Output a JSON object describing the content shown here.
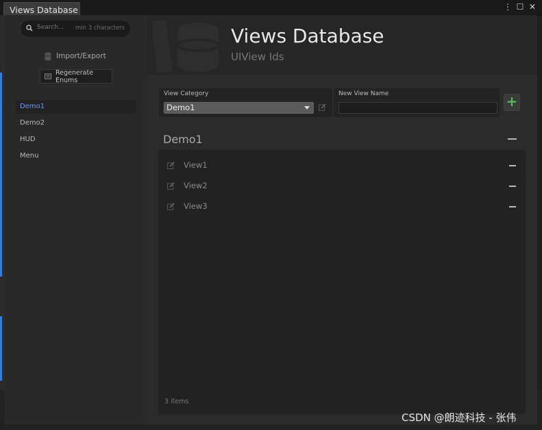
{
  "window": {
    "tab_title": "Views Database",
    "controls": {
      "more": "⋮",
      "maximize": "☐",
      "close": "✕"
    }
  },
  "sidebar": {
    "search": {
      "placeholder": "Search...",
      "hint": "min 3 characters"
    },
    "import_export_label": "Import/Export",
    "regenerate_label": "Regenerate Enums",
    "items": [
      {
        "label": "Demo1",
        "active": true
      },
      {
        "label": "Demo2",
        "active": false
      },
      {
        "label": "HUD",
        "active": false
      },
      {
        "label": "Menu",
        "active": false
      }
    ]
  },
  "header": {
    "title": "Views Database",
    "subtitle": "UIView Ids"
  },
  "form": {
    "category_label": "View Category",
    "category_value": "Demo1",
    "new_name_label": "New View Name",
    "new_name_value": "",
    "add_label": "+"
  },
  "section": {
    "title": "Demo1",
    "views": [
      {
        "name": "View1"
      },
      {
        "name": "View2"
      },
      {
        "name": "View3"
      }
    ],
    "count_text": "3 items"
  },
  "watermark": "CSDN @朗迹科技 - 张伟",
  "colors": {
    "accent_blue": "#6b9cff",
    "add_green": "#5cb85c",
    "background": "#2b2b2b"
  }
}
